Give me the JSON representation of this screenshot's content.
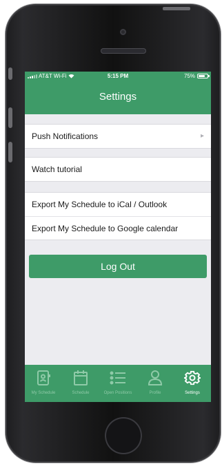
{
  "status_bar": {
    "carrier": "AT&T Wi-Fi",
    "time": "5:15 PM",
    "battery": "75%",
    "battery_level": 0.75
  },
  "header": {
    "title": "Settings"
  },
  "settings_groups": [
    {
      "items": [
        {
          "label": "Push Notifications",
          "has_chevron": true
        }
      ]
    },
    {
      "items": [
        {
          "label": "Watch tutorial"
        }
      ]
    },
    {
      "items": [
        {
          "label": "Export My Schedule to iCal / Outlook"
        },
        {
          "label": "Export My Schedule to Google calendar"
        }
      ]
    }
  ],
  "logout_label": "Log Out",
  "tabs": [
    {
      "label": "My Schedule",
      "icon": "id-card-icon",
      "active": false
    },
    {
      "label": "Schedule",
      "icon": "calendar-icon",
      "active": false
    },
    {
      "label": "Open Positions",
      "icon": "list-icon",
      "active": false
    },
    {
      "label": "Profile",
      "icon": "person-icon",
      "active": false
    },
    {
      "label": "Settings",
      "icon": "gear-icon",
      "active": true
    }
  ],
  "colors": {
    "brand_green": "#3e9b68",
    "inactive_tab": "#8fcaa8",
    "screen_background": "#ececf0"
  }
}
